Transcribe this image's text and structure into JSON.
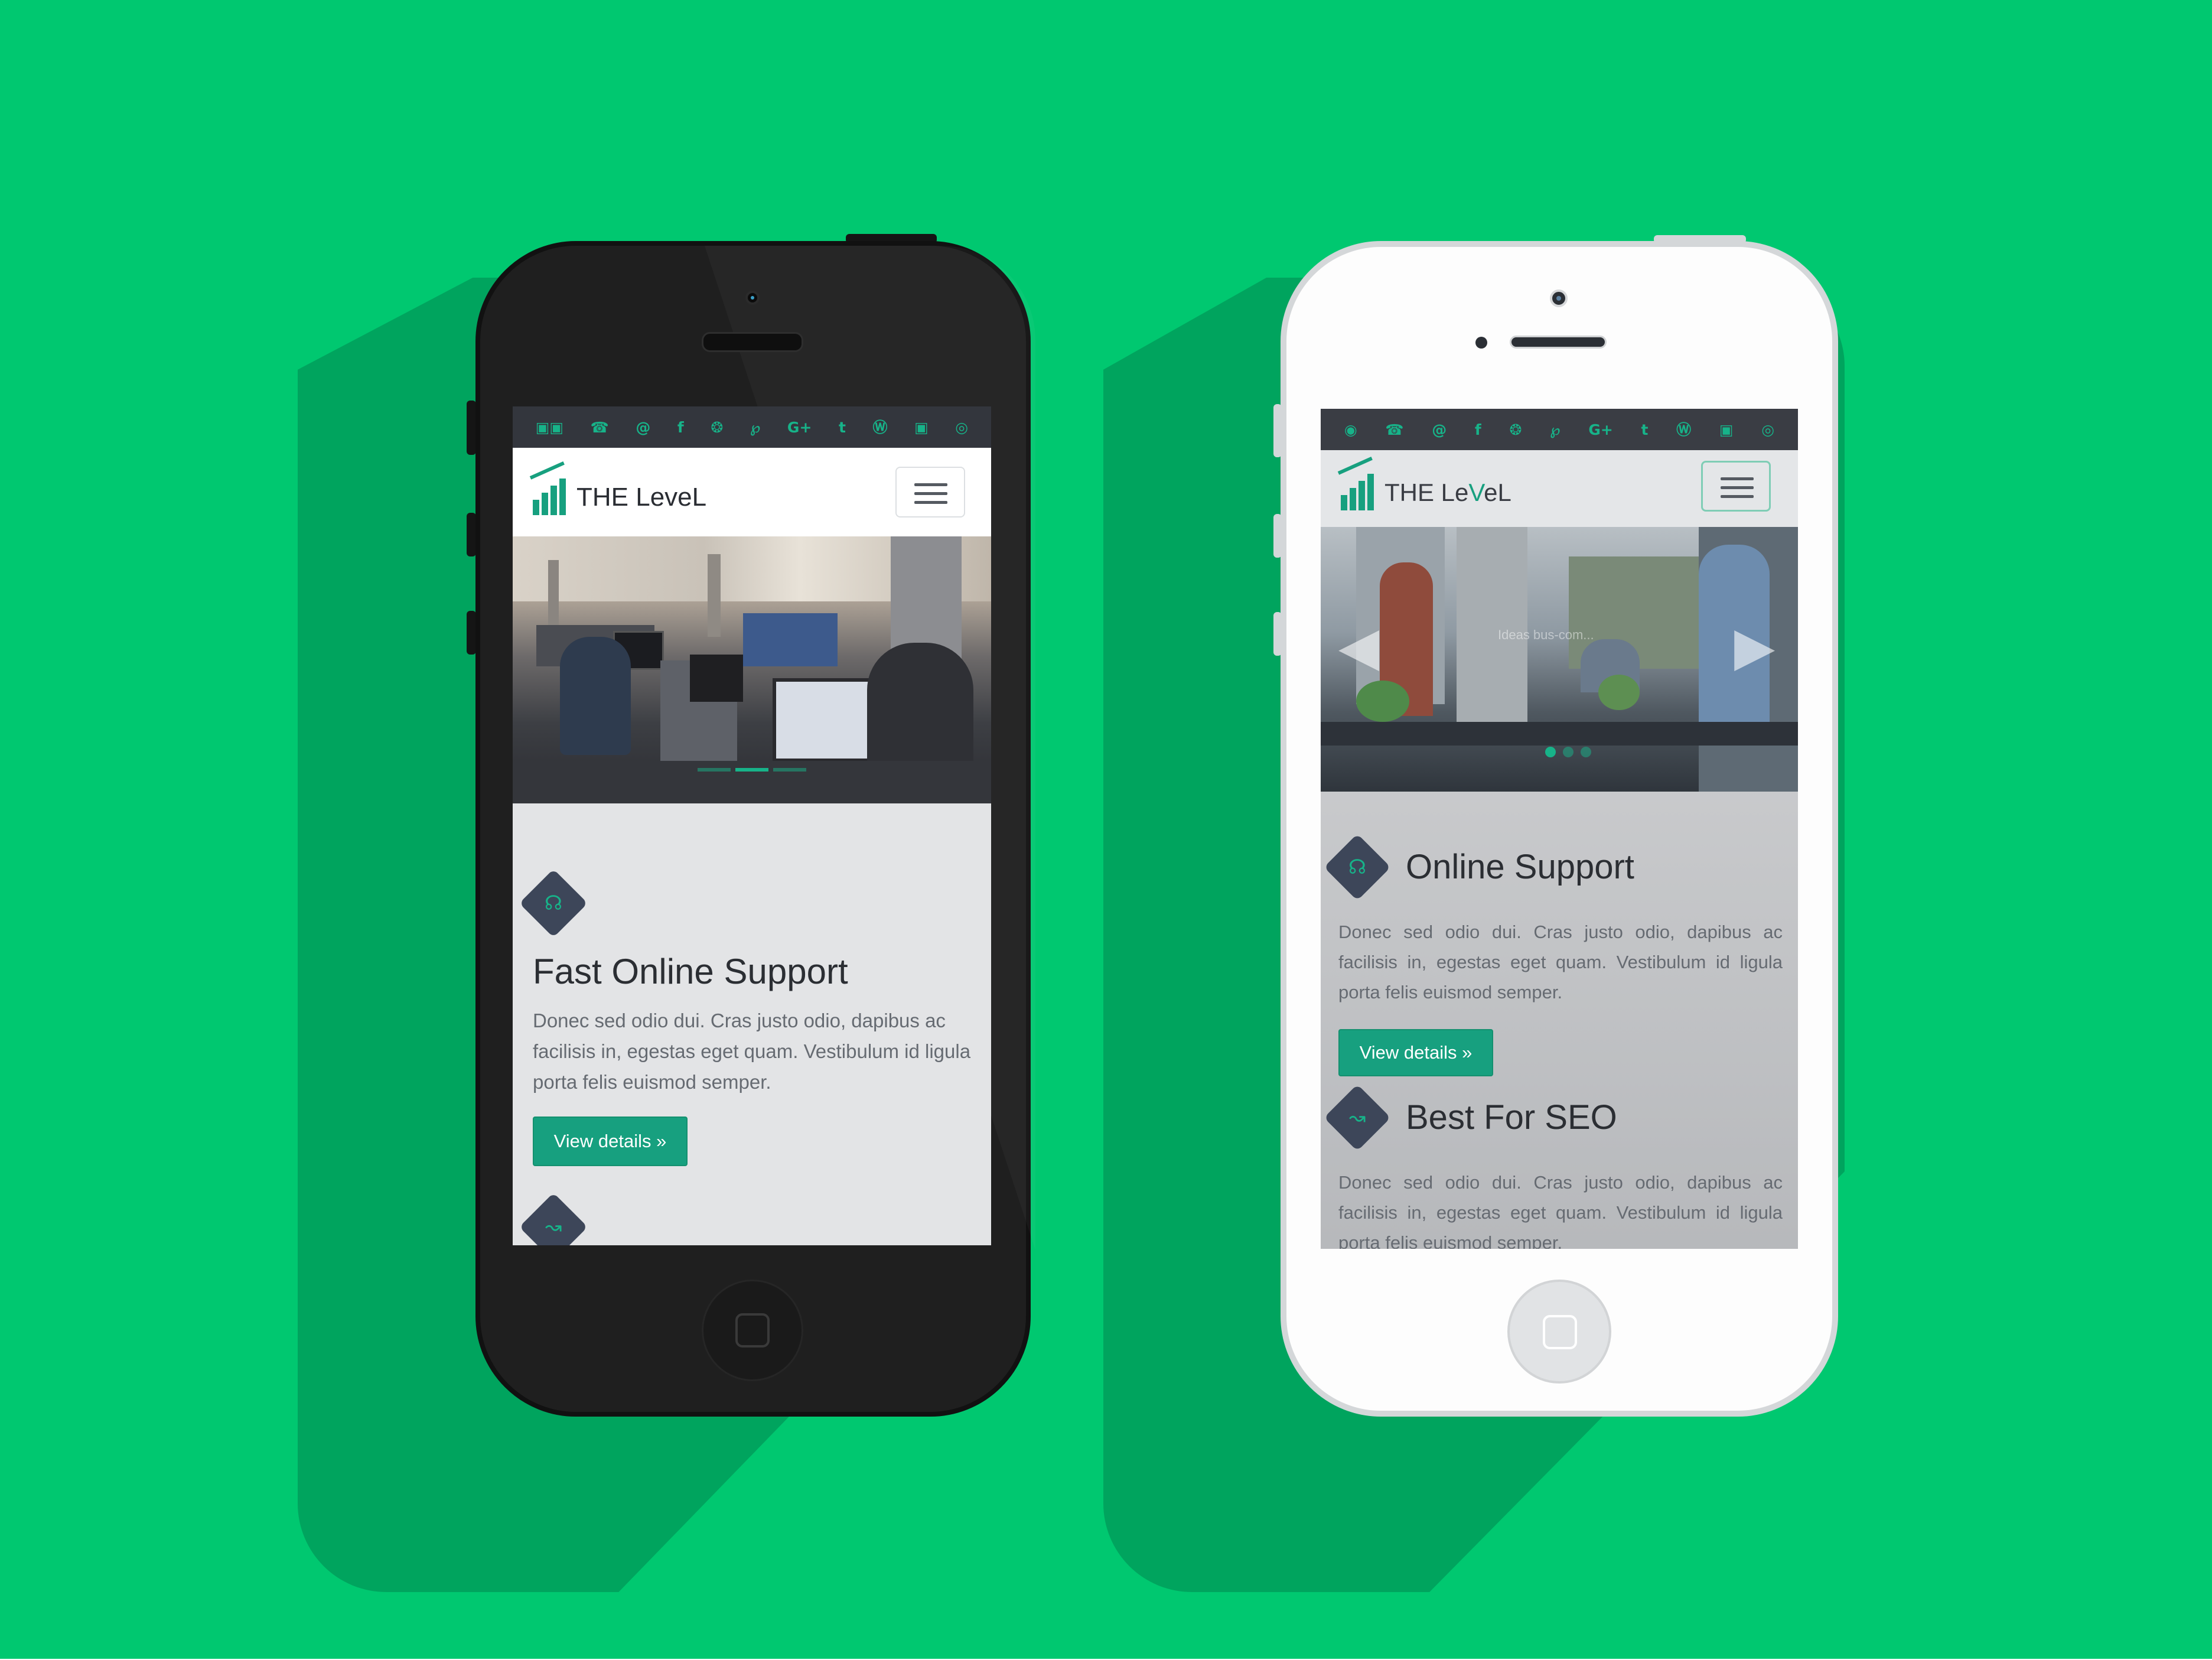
{
  "phones": [
    {
      "id": "black",
      "topbar_icons": [
        "▣▣",
        "☎",
        "@",
        "f",
        "❂",
        "℘",
        "G+",
        "t",
        "Ⓦ",
        "▣",
        "◎"
      ],
      "brand": {
        "prefix": "THE ",
        "mid": "LeveL",
        "accent": "",
        "suffix": ""
      },
      "feature": {
        "title": "Fast Online Support",
        "text": "Donec sed odio dui. Cras justo odio, dapibus ac facilisis in, egestas eget quam. Vestibulum id ligula porta felis euismod semper.",
        "button": "View details »",
        "icon": "headphones-icon"
      },
      "next_icon": "chart-icon"
    },
    {
      "id": "white",
      "topbar_icons": [
        "◉",
        "☎",
        "@",
        "f",
        "❂",
        "℘",
        "G+",
        "t",
        "Ⓦ",
        "▣",
        "◎"
      ],
      "brand": {
        "prefix": "THE Le",
        "mid": "",
        "accent": "V",
        "suffix": "eL"
      },
      "hero_caption": "Ideas bus-com...",
      "features": [
        {
          "title": "Online Support",
          "text": "Donec sed odio dui. Cras justo odio, dapibus ac facilisis in, egestas eget quam. Vestibulum id ligula porta felis euismod semper.",
          "button": "View details »",
          "icon": "headphones-icon"
        },
        {
          "title": "Best For SEO",
          "text": "Donec sed odio dui. Cras justo odio, dapibus ac facilisis in, egestas eget quam. Vestibulum id ligula porta felis euismod semper.",
          "icon": "chart-icon"
        }
      ]
    }
  ],
  "colors": {
    "background": "#00c870",
    "shadow": "#00a45e",
    "accent": "#17a07f",
    "topbar": "#33363d",
    "icon_diamond": "#3d4659"
  }
}
